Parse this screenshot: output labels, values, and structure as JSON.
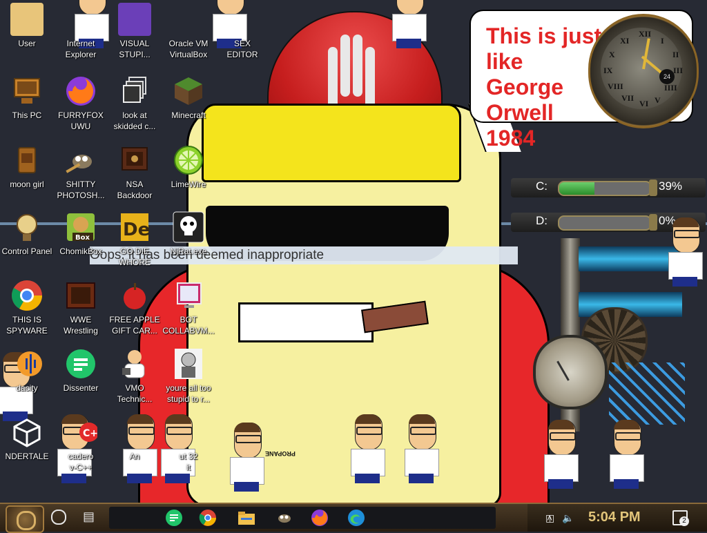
{
  "wallpaper": {
    "speech_bubble": "This is just like\nGeorge Orwell\n1984",
    "browser_text": "Oops, it has been deemed inappropriate",
    "clock_numerals": [
      "XII",
      "I",
      "II",
      "III",
      "IIII",
      "V",
      "VI",
      "VII",
      "VIII",
      "IX",
      "X",
      "XI"
    ],
    "clock_inner": "24",
    "propane_tag": "PROPANE"
  },
  "desktop_icons": [
    {
      "label": "User",
      "icon": "user-folder-icon"
    },
    {
      "label": "Internet\nExplorer",
      "icon": "internet-explorer-icon"
    },
    {
      "label": "VISUAL\nSTUPI...",
      "icon": "visual-studio-icon"
    },
    {
      "label": "Oracle VM\nVirtualBox",
      "icon": "virtualbox-icon"
    },
    {
      "label": "SEX\nEDITOR",
      "icon": "sex-editor-icon"
    },
    {
      "label": "This PC",
      "icon": "this-pc-icon"
    },
    {
      "label": "FURRYFOX\nUWU",
      "icon": "firefox-icon"
    },
    {
      "label": "look at\nskidded c...",
      "icon": "copy-files-icon"
    },
    {
      "label": "Minecraft",
      "icon": "minecraft-icon"
    },
    {
      "label": "moon girl",
      "icon": "moon-girl-icon"
    },
    {
      "label": "SHITTY\nPHOTOSH...",
      "icon": "gimp-icon"
    },
    {
      "label": "NSA\nBackdoor",
      "icon": "nsa-backdoor-icon"
    },
    {
      "label": "LimeWire",
      "icon": "limewire-icon"
    },
    {
      "label": "Control Panel",
      "icon": "control-panel-icon"
    },
    {
      "label": "ChomikBox",
      "icon": "chomikbox-icon"
    },
    {
      "label": "GO DIE\nWHORE",
      "icon": "dreamweaver-icon"
    },
    {
      "label": "NjRat.exe",
      "icon": "skull-icon"
    },
    {
      "label": "THIS IS\nSPYWARE",
      "icon": "chrome-icon"
    },
    {
      "label": "WWE\nWrestling",
      "icon": "wwe-icon"
    },
    {
      "label": "FREE APPLE\nGIFT CAR...",
      "icon": "apple-icon"
    },
    {
      "label": "BOT\nCOLLABVM...",
      "icon": "collabvm-icon"
    },
    {
      "label": "dacity",
      "icon": "audacity-icon"
    },
    {
      "label": "Dissenter",
      "icon": "dissenter-icon"
    },
    {
      "label": "VMO\nTechnic...",
      "icon": "doctor-icon"
    },
    {
      "label": "youre all too\nstupid to r...",
      "icon": "portrait-icon"
    },
    {
      "label": "NDERTALE",
      "icon": "unity-icon"
    },
    {
      "label": "cadero\nv-C++",
      "icon": "embarcadero-icon"
    },
    {
      "label": "An",
      "icon": "an-icon"
    },
    {
      "label": "ut 32\nit",
      "icon": "ut32-icon"
    }
  ],
  "gauges": {
    "c_label": "C:",
    "c_percent": "39%",
    "c_fill": 0.39,
    "d_label": "D:",
    "d_percent": "0%",
    "d_fill": 0.0
  },
  "taskbar": {
    "time": "5:04 PM",
    "notification_count": "2",
    "pinned": [
      "dissenter-taskbar",
      "chrome-taskbar",
      "file-explorer-taskbar",
      "gimp-taskbar",
      "firefox-taskbar",
      "edge-taskbar"
    ]
  }
}
